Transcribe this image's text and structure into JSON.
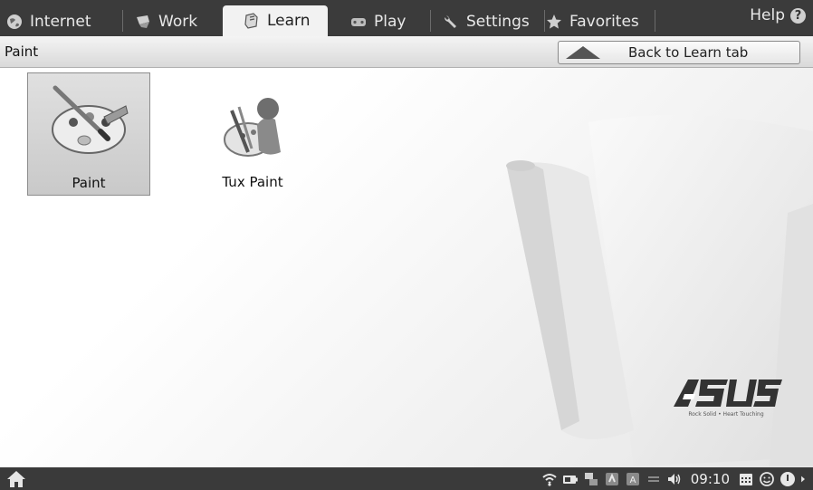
{
  "tabs": [
    {
      "label": "Internet",
      "icon": "globe-icon"
    },
    {
      "label": "Work",
      "icon": "work-icon"
    },
    {
      "label": "Learn",
      "icon": "learn-icon",
      "active": true
    },
    {
      "label": "Play",
      "icon": "play-icon"
    },
    {
      "label": "Settings",
      "icon": "wrench-icon"
    },
    {
      "label": "Favorites",
      "icon": "star-icon"
    }
  ],
  "help": {
    "label": "Help",
    "icon": "help-icon"
  },
  "subheader": {
    "title": "Paint",
    "back_label": "Back to Learn tab"
  },
  "apps": [
    {
      "label": "Paint",
      "icon": "palette-brush-icon",
      "selected": true
    },
    {
      "label": "Tux Paint",
      "icon": "tux-paint-icon",
      "selected": false
    }
  ],
  "brand": {
    "tagline": "Rock Solid • Heart Touching"
  },
  "taskbar": {
    "clock": "09:10",
    "tray_icons": [
      "wifi-icon",
      "battery-icon",
      "network-icon",
      "app-icon",
      "keyboard-icon",
      "signal-icon",
      "volume-icon",
      "calendar-icon",
      "smiley-icon",
      "power-icon",
      "arrow-right-icon"
    ]
  },
  "colors": {
    "tabbar": "#3b3b3b",
    "active_tab": "#f2f2f2",
    "taskbar": "#3a3a3a"
  }
}
